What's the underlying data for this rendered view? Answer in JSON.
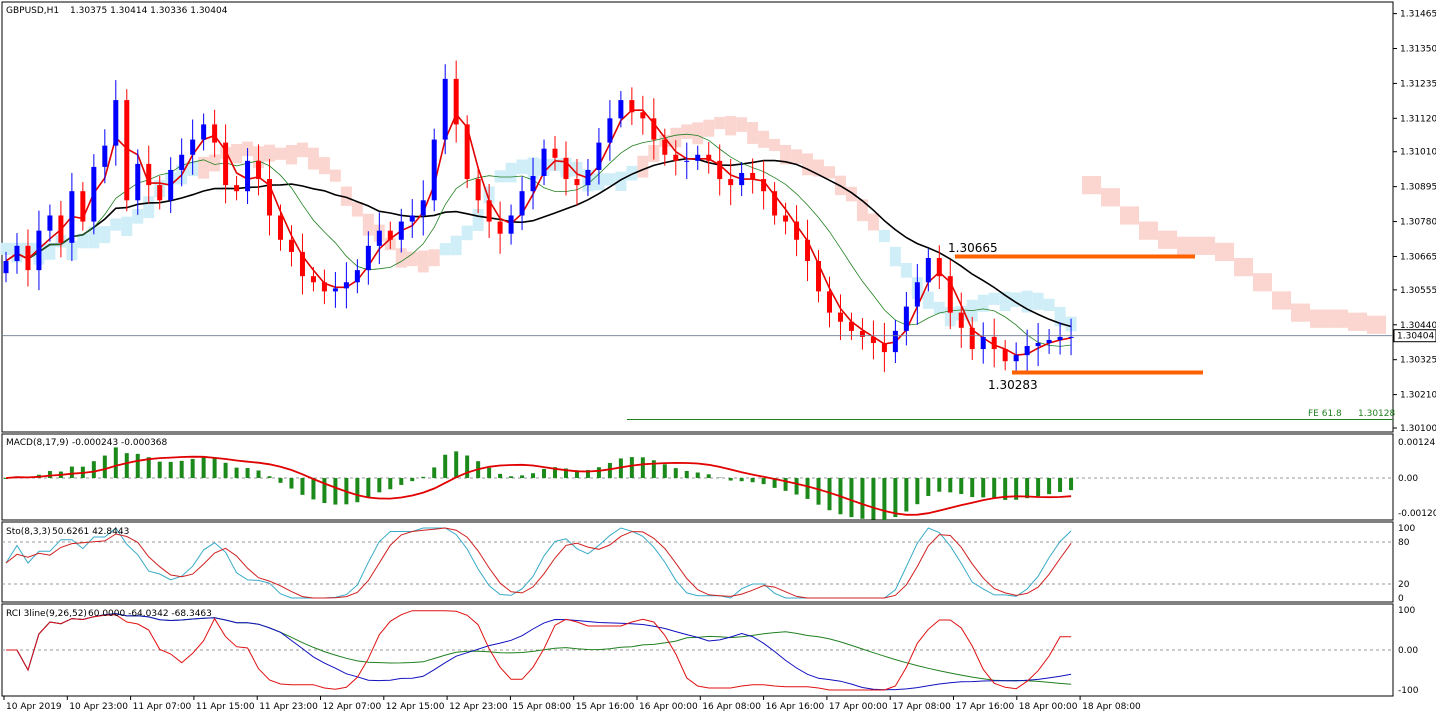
{
  "chart_data": {
    "type": "candlestick",
    "symbol": "GBPUSD,H1",
    "ohlc_readout": "1.30375 1.30414 1.30336 1.30404",
    "price_axis": {
      "ticks": [
        "1.31465",
        "1.31350",
        "1.31235",
        "1.31120",
        "1.31010",
        "1.30895",
        "1.30780",
        "1.30665",
        "1.30555",
        "1.30440",
        "1.30325",
        "1.30210",
        "1.30100"
      ],
      "current_price": "1.30404",
      "range": [
        1.301,
        1.3149
      ]
    },
    "time_axis": [
      "10 Apr 2019",
      "10 Apr 23:00",
      "11 Apr 07:00",
      "11 Apr 15:00",
      "11 Apr 23:00",
      "12 Apr 07:00",
      "12 Apr 15:00",
      "12 Apr 23:00",
      "15 Apr 08:00",
      "15 Apr 16:00",
      "16 Apr 00:00",
      "16 Apr 08:00",
      "16 Apr 16:00",
      "17 Apr 00:00",
      "17 Apr 08:00",
      "17 Apr 16:00",
      "18 Apr 00:00",
      "18 Apr 08:00"
    ],
    "annotations": {
      "high_label": "1.30665",
      "low_label": "1.30283",
      "fe_label": "FE 61.8",
      "fe_value": "1.30128"
    },
    "close_series": [
      1.3065,
      1.307,
      1.3062,
      1.3075,
      1.308,
      1.3071,
      1.3088,
      1.3078,
      1.3096,
      1.3103,
      1.3118,
      1.3085,
      1.3097,
      1.309,
      1.3085,
      1.3095,
      1.31,
      1.3105,
      1.311,
      1.3104,
      1.309,
      1.3088,
      1.3098,
      1.3092,
      1.308,
      1.3072,
      1.3068,
      1.306,
      1.3058,
      1.3055,
      1.3056,
      1.3058,
      1.3062,
      1.307,
      1.3075,
      1.3072,
      1.3078,
      1.308,
      1.3085,
      1.3105,
      1.3125,
      1.311,
      1.3092,
      1.3085,
      1.3078,
      1.3074,
      1.308,
      1.3088,
      1.3093,
      1.3102,
      1.3099,
      1.3092,
      1.309,
      1.3095,
      1.3104,
      1.3112,
      1.3118,
      1.3114,
      1.3112,
      1.3105,
      1.31,
      1.3098,
      1.3098,
      1.31,
      1.3098,
      1.3092,
      1.309,
      1.3094,
      1.3092,
      1.3088,
      1.308,
      1.3078,
      1.3072,
      1.3065,
      1.3055,
      1.3048,
      1.3045,
      1.3042,
      1.304,
      1.3038,
      1.3035,
      1.3042,
      1.305,
      1.3058,
      1.3066,
      1.306,
      1.3048,
      1.3043,
      1.3036,
      1.304,
      1.3036,
      1.3032,
      1.3034,
      1.3037,
      1.3038,
      1.3039,
      1.304,
      1.304
    ],
    "indicators": [
      {
        "name": "MACD(8,17,9)",
        "readout": "-0.000243 -0.000368",
        "ticks": [
          "0.001241",
          "0.00",
          "-0.001201"
        ]
      },
      {
        "name": "Sto(8,3,3)",
        "readout": "50.6261 42.8443",
        "ticks": [
          "100",
          "80",
          "20",
          "0"
        ]
      },
      {
        "name": "RCI 3line(9,26,52)",
        "readout": "60.0000 -64.0342 -68.3463",
        "ticks": [
          "100",
          "0.00",
          "-100"
        ]
      }
    ]
  },
  "colors": {
    "bull": "#0000ff",
    "bear": "#ff0000",
    "ma_fast": "#e00000",
    "ma_mid": "#208020",
    "ma_slow": "#000000",
    "cloud_bull": "#cfeef8",
    "cloud_bear": "#fbd5d0",
    "hline": "#ff6000",
    "macd_hist": "#1b8a1b",
    "macd_signal": "#e00000",
    "sto_k": "#38aac8",
    "sto_d": "#d02020",
    "rci_short": "#e01010",
    "rci_mid": "#1010c0",
    "rci_long": "#208020"
  }
}
